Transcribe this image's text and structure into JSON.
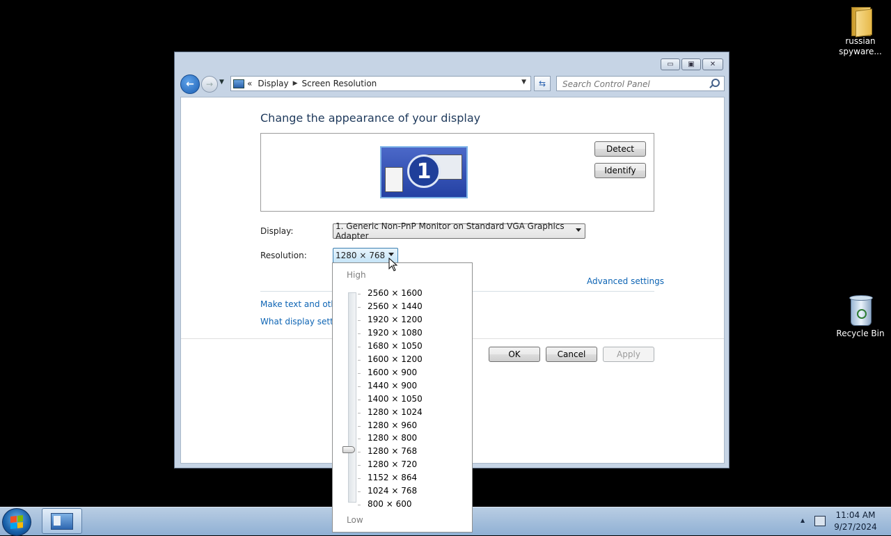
{
  "desktop": {
    "icons": [
      {
        "label": "russian spyware..."
      },
      {
        "label": "Recycle Bin"
      }
    ]
  },
  "window": {
    "caption_buttons": [
      "minimize",
      "maximize",
      "close"
    ],
    "breadcrumb": {
      "prefix": "«",
      "items": [
        "Display",
        "Screen Resolution"
      ]
    },
    "search_placeholder": "Search Control Panel",
    "heading": "Change the appearance of your display",
    "monitor_number": "1",
    "buttons": {
      "detect": "Detect",
      "identify": "Identify",
      "ok": "OK",
      "cancel": "Cancel",
      "apply": "Apply"
    },
    "display_label": "Display:",
    "display_value": "1. Generic Non-PnP Monitor on Standard VGA Graphics Adapter",
    "resolution_label": "Resolution:",
    "resolution_value": "1280 × 768",
    "advanced_link": "Advanced settings",
    "link_text_size": "Make text and other",
    "link_display_settings": "What display setting"
  },
  "resolution_dropdown": {
    "high_label": "High",
    "low_label": "Low",
    "options": [
      "2560 × 1600",
      "2560 × 1440",
      "1920 × 1200",
      "1920 × 1080",
      "1680 × 1050",
      "1600 × 1200",
      "1600 × 900",
      "1440 × 900",
      "1400 × 1050",
      "1280 × 1024",
      "1280 × 960",
      "1280 × 800",
      "1280 × 768",
      "1280 × 720",
      "1152 × 864",
      "1024 × 768",
      "800 × 600"
    ],
    "selected": "1280 × 768"
  },
  "taskbar": {
    "time": "11:04 AM",
    "date": "9/27/2024"
  },
  "colors": {
    "link": "#0d64b4",
    "heading": "#1e395b",
    "taskbar": "#8fb0d4"
  }
}
